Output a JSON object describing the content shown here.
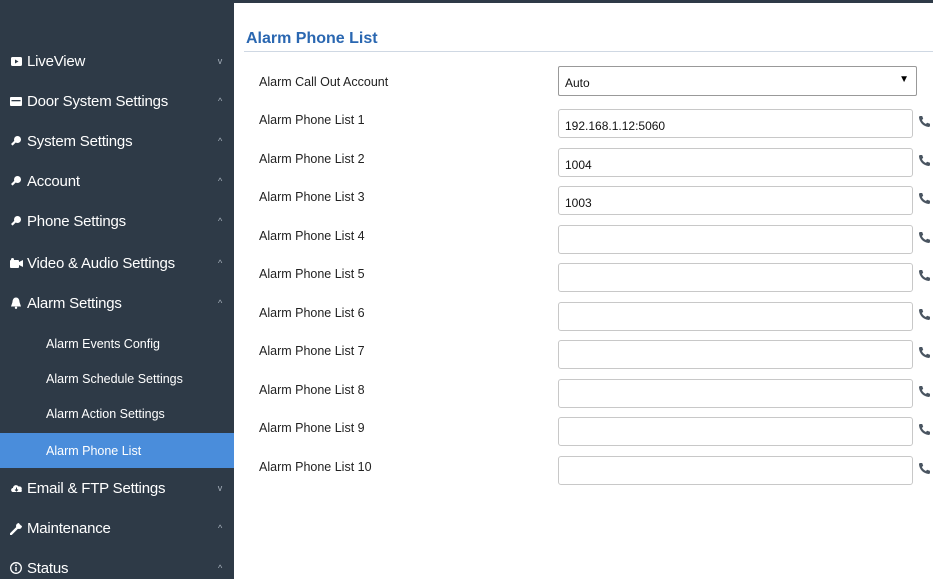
{
  "sidebar": {
    "items": [
      {
        "label": "LiveView",
        "icon": "tv-icon",
        "chevron": "v"
      },
      {
        "label": "Door System Settings",
        "icon": "door-icon",
        "chevron": "^"
      },
      {
        "label": "System Settings",
        "icon": "gear-icon",
        "chevron": "^"
      },
      {
        "label": "Account",
        "icon": "account-icon",
        "chevron": "^"
      },
      {
        "label": "Phone Settings",
        "icon": "phone-settings-icon",
        "chevron": "^"
      },
      {
        "label": "Video & Audio Settings",
        "icon": "camera-icon",
        "chevron": "^"
      },
      {
        "label": "Alarm Settings",
        "icon": "bell-icon",
        "chevron": "^"
      },
      {
        "label": "Email & FTP Settings",
        "icon": "cloud-icon",
        "chevron": "v"
      },
      {
        "label": "Maintenance",
        "icon": "wrench-icon",
        "chevron": "^"
      },
      {
        "label": "Status",
        "icon": "info-icon",
        "chevron": "^"
      }
    ],
    "alarm_subitems": [
      {
        "label": "Alarm Events Config"
      },
      {
        "label": "Alarm Schedule Settings"
      },
      {
        "label": "Alarm Action Settings"
      },
      {
        "label": "Alarm Phone List"
      }
    ],
    "accent_color": "#4a8ddb"
  },
  "main": {
    "title": "Alarm Phone List",
    "callout": {
      "label": "Alarm Call Out Account",
      "value": "Auto"
    },
    "rows": [
      {
        "label": "Alarm Phone List 1",
        "value": "192.168.1.12:5060"
      },
      {
        "label": "Alarm Phone List 2",
        "value": "1004"
      },
      {
        "label": "Alarm Phone List 3",
        "value": "1003"
      },
      {
        "label": "Alarm Phone List 4",
        "value": ""
      },
      {
        "label": "Alarm Phone List 5",
        "value": ""
      },
      {
        "label": "Alarm Phone List 6",
        "value": ""
      },
      {
        "label": "Alarm Phone List 7",
        "value": ""
      },
      {
        "label": "Alarm Phone List 8",
        "value": ""
      },
      {
        "label": "Alarm Phone List 9",
        "value": ""
      },
      {
        "label": "Alarm Phone List 10",
        "value": ""
      }
    ]
  }
}
